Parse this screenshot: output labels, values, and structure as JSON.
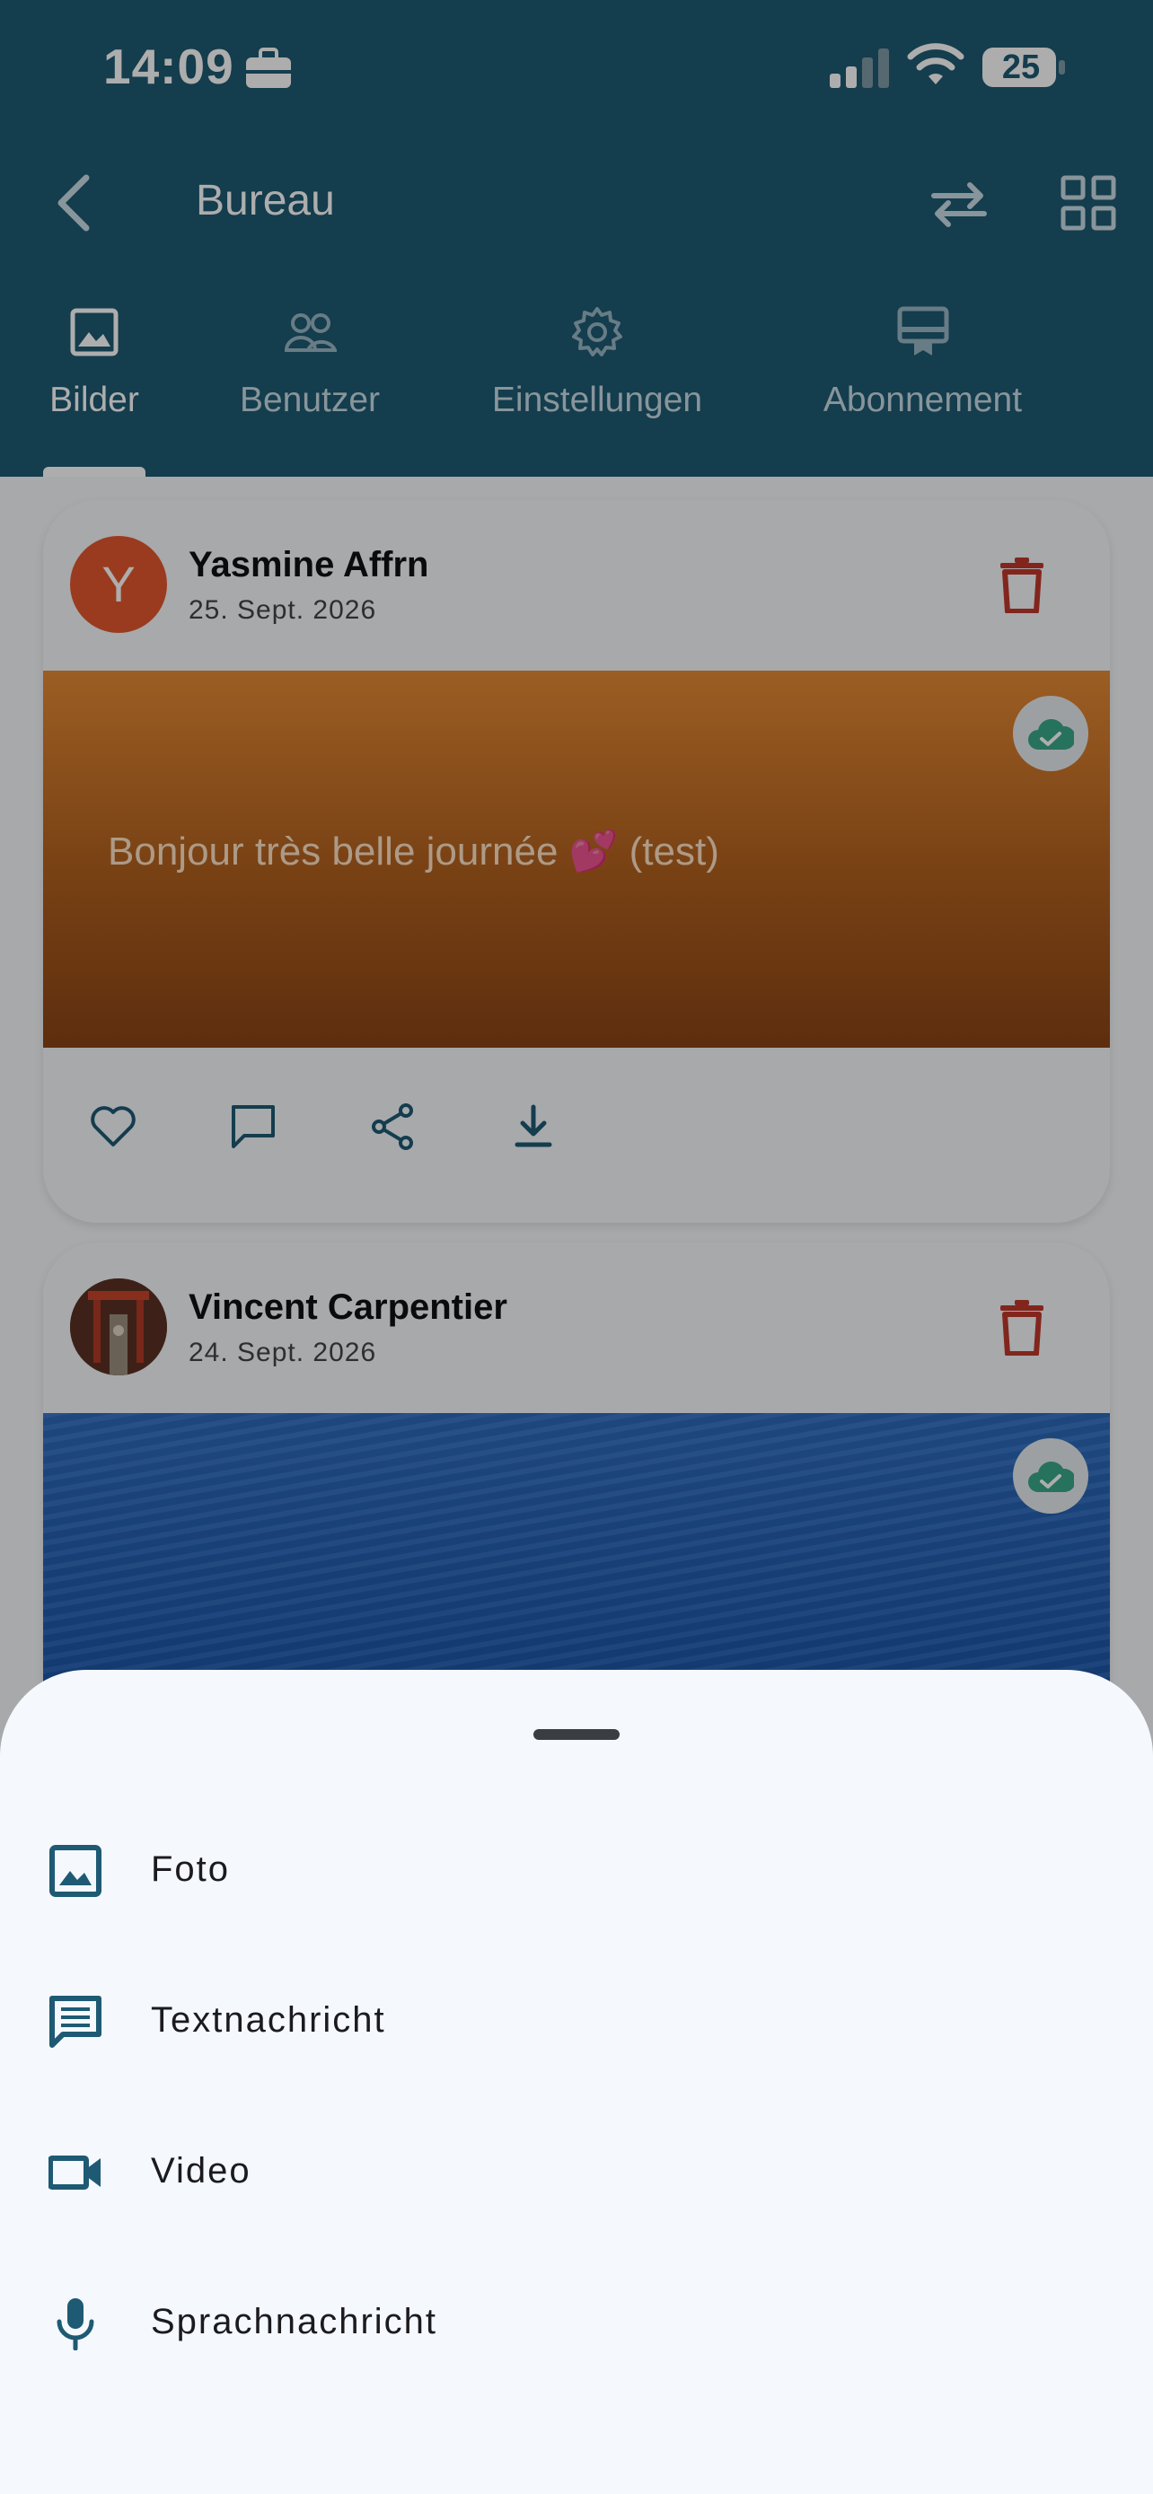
{
  "status_bar": {
    "time": "14:09",
    "battery": "25"
  },
  "app_bar": {
    "title": "Bureau",
    "back_icon": "chevron-left-icon",
    "swap_icon": "swap-icon",
    "grid_icon": "grid-icon"
  },
  "tabs": [
    {
      "label": "Bilder",
      "icon": "image-icon",
      "active": true
    },
    {
      "label": "Benutzer",
      "icon": "users-icon",
      "active": false
    },
    {
      "label": "Einstellungen",
      "icon": "gear-icon",
      "active": false
    },
    {
      "label": "Abonnement",
      "icon": "subscription-icon",
      "active": false
    }
  ],
  "posts": [
    {
      "avatar_letter": "Y",
      "author": "Yasmine Affrn",
      "date": "25. Sept. 2026",
      "text": "Bonjour très belle journée 💕  (test)",
      "type": "text"
    },
    {
      "author": "Vincent Carpentier",
      "date": "24. Sept. 2026",
      "type": "image"
    }
  ],
  "sheet": {
    "items": [
      {
        "label": "Foto",
        "icon": "image-icon"
      },
      {
        "label": "Textnachricht",
        "icon": "message-icon"
      },
      {
        "label": "Video",
        "icon": "video-icon"
      },
      {
        "label": "Sprachnachricht",
        "icon": "mic-icon"
      }
    ]
  },
  "colors": {
    "header": "#1e5a73",
    "accent": "#1e5a73",
    "delete": "#c0392b",
    "sync": "#3aa88a"
  }
}
